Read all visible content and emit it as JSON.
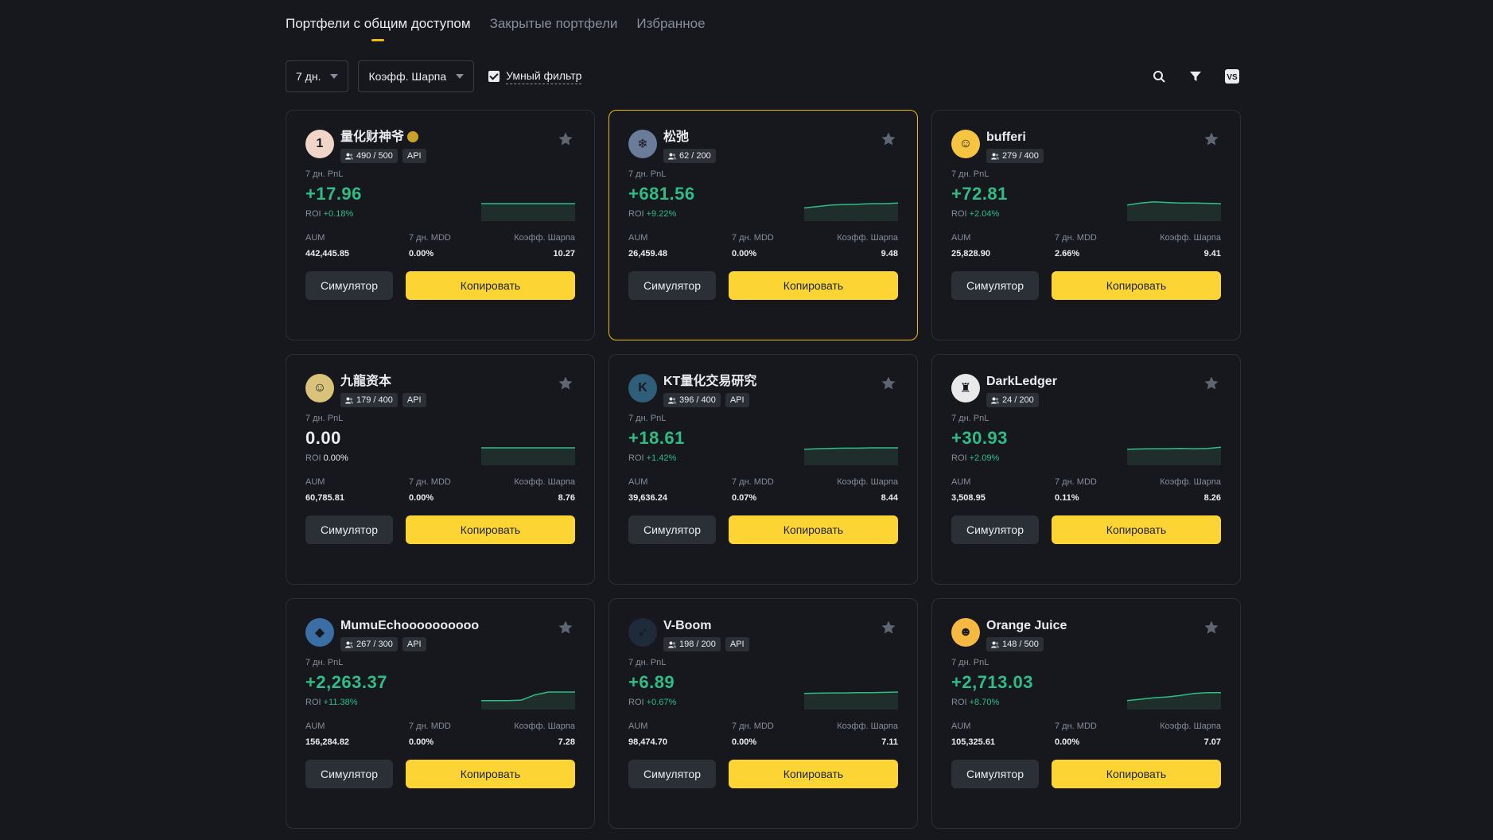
{
  "tabs": [
    {
      "label": "Портфели с общим доступом",
      "active": true
    },
    {
      "label": "Закрытые портфели",
      "active": false
    },
    {
      "label": "Избранное",
      "active": false
    }
  ],
  "filters": {
    "period": "7 дн.",
    "sort": "Коэфф. Шарпа",
    "smart_filter_label": "Умный фильтр",
    "smart_filter_checked": true
  },
  "toolbar_icons": [
    "search-icon",
    "filter-icon",
    "vs-icon"
  ],
  "colors": {
    "accent": "#fcd535",
    "positive": "#2ebd85",
    "bg": "#17181e",
    "card_border": "#2b2f36"
  },
  "card_labels": {
    "pnl_label": "7 дн. PnL",
    "roi_label": "ROI",
    "aum_label": "AUM",
    "mdd_label": "7 дн. MDD",
    "sharpe_label": "Коэфф. Шарпа",
    "simulator": "Симулятор",
    "copy": "Копировать",
    "api": "API"
  },
  "cards": [
    {
      "name": "量化财神爷",
      "followers": "490 / 500",
      "api": true,
      "pnl": "+17.96",
      "roi": "+0.18%",
      "aum": "442,445.85",
      "mdd": "0.00%",
      "sharpe": "10.27",
      "avatar_color": "#f0d5c8",
      "avatar_glyph": "1",
      "highlight": false,
      "spark": [
        0.5,
        0.5,
        0.5,
        0.5,
        0.5,
        0.5,
        0.5,
        0.5
      ],
      "verified": true
    },
    {
      "name": "松弛",
      "followers": "62 / 200",
      "api": false,
      "pnl": "+681.56",
      "roi": "+9.22%",
      "aum": "26,459.48",
      "mdd": "0.00%",
      "sharpe": "9.48",
      "avatar_color": "#6b7b9a",
      "avatar_glyph": "❄",
      "highlight": true,
      "spark": [
        0.35,
        0.4,
        0.45,
        0.47,
        0.48,
        0.5,
        0.5,
        0.52
      ]
    },
    {
      "name": "bufferi",
      "followers": "279 / 400",
      "api": false,
      "pnl": "+72.81",
      "roi": "+2.04%",
      "aum": "25,828.90",
      "mdd": "2.66%",
      "sharpe": "9.41",
      "avatar_color": "#f5c542",
      "avatar_glyph": "☺",
      "highlight": false,
      "spark": [
        0.45,
        0.52,
        0.56,
        0.54,
        0.52,
        0.52,
        0.51,
        0.5
      ]
    },
    {
      "name": "九龍资本",
      "followers": "179 / 400",
      "api": true,
      "pnl": "0.00",
      "roi": "0.00%",
      "aum": "60,785.81",
      "mdd": "0.00%",
      "sharpe": "8.76",
      "avatar_color": "#d9c27a",
      "avatar_glyph": "☺",
      "highlight": false,
      "spark": [
        0.5,
        0.5,
        0.5,
        0.5,
        0.5,
        0.5,
        0.5,
        0.5
      ],
      "neutral": true
    },
    {
      "name": "KT量化交易研究",
      "followers": "396 / 400",
      "api": true,
      "pnl": "+18.61",
      "roi": "+1.42%",
      "aum": "39,636.24",
      "mdd": "0.07%",
      "sharpe": "8.44",
      "avatar_color": "#2f5e7a",
      "avatar_glyph": "K",
      "highlight": false,
      "spark": [
        0.45,
        0.47,
        0.48,
        0.49,
        0.49,
        0.5,
        0.5,
        0.5
      ]
    },
    {
      "name": "DarkLedger",
      "followers": "24 / 200",
      "api": false,
      "pnl": "+30.93",
      "roi": "+2.09%",
      "aum": "3,508.95",
      "mdd": "0.11%",
      "sharpe": "8.26",
      "avatar_color": "#e9e9e9",
      "avatar_glyph": "♜",
      "highlight": false,
      "spark": [
        0.45,
        0.46,
        0.47,
        0.47,
        0.48,
        0.47,
        0.48,
        0.52
      ]
    },
    {
      "name": "MumuEchoooooooooo",
      "followers": "267 / 300",
      "api": true,
      "pnl": "+2,263.37",
      "roi": "+11.38%",
      "aum": "156,284.82",
      "mdd": "0.00%",
      "sharpe": "7.28",
      "avatar_color": "#3b6ea5",
      "avatar_glyph": "◆",
      "highlight": false,
      "spark": [
        0.2,
        0.2,
        0.2,
        0.22,
        0.4,
        0.5,
        0.5,
        0.5
      ]
    },
    {
      "name": "V-Boom",
      "followers": "198 / 200",
      "api": true,
      "pnl": "+6.89",
      "roi": "+0.67%",
      "aum": "98,474.70",
      "mdd": "0.00%",
      "sharpe": "7.11",
      "avatar_color": "#1f2a3a",
      "avatar_glyph": "➶",
      "highlight": false,
      "spark": [
        0.45,
        0.46,
        0.47,
        0.47,
        0.48,
        0.48,
        0.49,
        0.5
      ]
    },
    {
      "name": "Orange Juice",
      "followers": "148 / 500",
      "api": false,
      "pnl": "+2,713.03",
      "roi": "+8.70%",
      "aum": "105,325.61",
      "mdd": "0.00%",
      "sharpe": "7.07",
      "avatar_color": "#f5b942",
      "avatar_glyph": "☻",
      "highlight": false,
      "spark": [
        0.2,
        0.25,
        0.3,
        0.33,
        0.38,
        0.45,
        0.48,
        0.48
      ]
    }
  ]
}
